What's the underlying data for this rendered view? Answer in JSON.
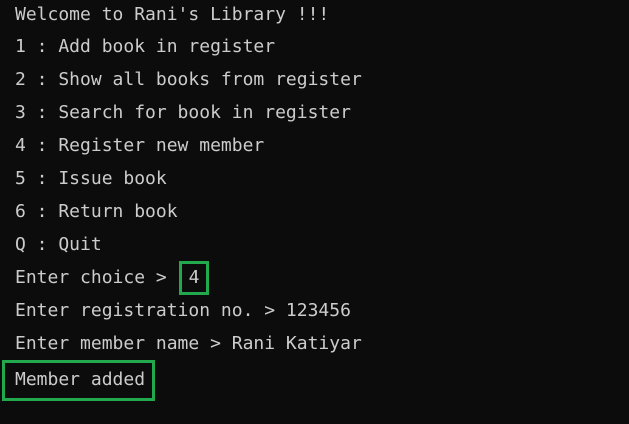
{
  "terminal": {
    "lines": {
      "welcome": "Welcome to Rani's Library !!!",
      "menu_1": "1 : Add book in register",
      "menu_2": "2 : Show all books from register",
      "menu_3": "3 : Search for book in register",
      "menu_4": "4 : Register new member",
      "menu_5": "5 : Issue book",
      "menu_6": "6 : Return book",
      "menu_q": "Q : Quit",
      "choice_prompt": "Enter choice > ",
      "choice_value": "4",
      "registration_line": "Enter registration no. > 123456",
      "member_name_line": "Enter member name > Rani Katiyar",
      "result": "Member added"
    },
    "colors": {
      "background": "#0c0c0c",
      "text": "#cccccc",
      "highlight": "#22a94d"
    }
  }
}
